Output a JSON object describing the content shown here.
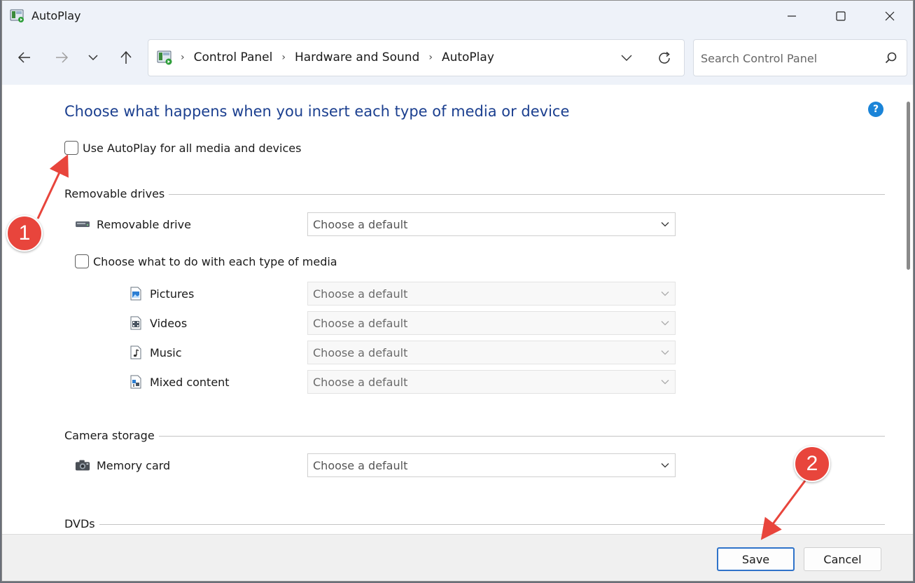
{
  "window": {
    "title": "AutoPlay"
  },
  "address": {
    "crumbs": [
      "Control Panel",
      "Hardware and Sound",
      "AutoPlay"
    ],
    "separator": "›"
  },
  "search": {
    "placeholder": "Search Control Panel"
  },
  "main": {
    "heading": "Choose what happens when you insert each type of media or device",
    "help": "?",
    "use_autoplay_label": "Use AutoPlay for all media and devices",
    "sections": {
      "removable": {
        "title": "Removable drives",
        "drive_label": "Removable drive",
        "drive_select": "Choose a default",
        "per_media_label": "Choose what to do with each type of media",
        "media": [
          {
            "label": "Pictures",
            "select": "Choose a default"
          },
          {
            "label": "Videos",
            "select": "Choose a default"
          },
          {
            "label": "Music",
            "select": "Choose a default"
          },
          {
            "label": "Mixed content",
            "select": "Choose a default"
          }
        ]
      },
      "camera": {
        "title": "Camera storage",
        "memory_label": "Memory card",
        "memory_select": "Choose a default"
      },
      "dvds": {
        "title": "DVDs"
      }
    }
  },
  "footer": {
    "save_label": "Save",
    "cancel_label": "Cancel"
  },
  "annotations": {
    "marker1": "1",
    "marker2": "2"
  },
  "colors": {
    "heading": "#1b3f8f",
    "accent": "#2f73c9",
    "marker": "#e8453c"
  },
  "icons": [
    "control-panel-icon",
    "back-arrow-icon",
    "forward-arrow-icon",
    "chevron-down-icon",
    "up-arrow-icon",
    "refresh-icon",
    "search-icon",
    "help-icon",
    "drive-icon",
    "picture-icon",
    "video-icon",
    "music-icon",
    "mixed-content-icon",
    "camera-icon"
  ]
}
